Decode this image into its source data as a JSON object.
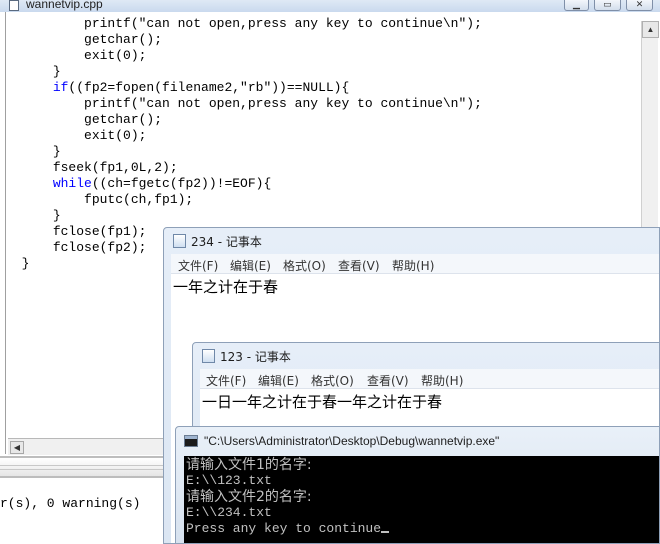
{
  "ide": {
    "title": "wannetvip.cpp",
    "code_lines": [
      {
        "indent": "        ",
        "kw": "",
        "text": "printf(\"can not open,press any key to continue\\n\");"
      },
      {
        "indent": "        ",
        "kw": "",
        "text": "getchar();"
      },
      {
        "indent": "        ",
        "kw": "",
        "text": "exit(0);"
      },
      {
        "indent": "    ",
        "kw": "",
        "text": "}"
      },
      {
        "indent": "    ",
        "kw": "if",
        "text": "((fp2=fopen(filename2,\"rb\"))==NULL){"
      },
      {
        "indent": "        ",
        "kw": "",
        "text": "printf(\"can not open,press any key to continue\\n\");"
      },
      {
        "indent": "        ",
        "kw": "",
        "text": "getchar();"
      },
      {
        "indent": "        ",
        "kw": "",
        "text": "exit(0);"
      },
      {
        "indent": "    ",
        "kw": "",
        "text": "}"
      },
      {
        "indent": "    ",
        "kw": "",
        "text": "fseek(fp1,0L,2);"
      },
      {
        "indent": "    ",
        "kw": "while",
        "text": "((ch=fgetc(fp2))!=EOF){"
      },
      {
        "indent": "        ",
        "kw": "",
        "text": "fputc(ch,fp1);"
      },
      {
        "indent": "    ",
        "kw": "",
        "text": "}"
      },
      {
        "indent": "    ",
        "kw": "",
        "text": "fclose(fp1);"
      },
      {
        "indent": "    ",
        "kw": "",
        "text": "fclose(fp2);"
      },
      {
        "indent": "",
        "kw": "",
        "text": "}"
      }
    ],
    "output_message": "r(s), 0 warning(s)",
    "keyword_color": "#0000ff"
  },
  "notepad_234": {
    "title": "234 - 记事本",
    "menu": [
      "文件(F)",
      "编辑(E)",
      "格式(O)",
      "查看(V)",
      "帮助(H)"
    ],
    "content": "一年之计在于春"
  },
  "notepad_123": {
    "title": "123 - 记事本",
    "menu": [
      "文件(F)",
      "编辑(E)",
      "格式(O)",
      "查看(V)",
      "帮助(H)"
    ],
    "content": "一日一年之计在于春一年之计在于春"
  },
  "console": {
    "title": "\"C:\\Users\\Administrator\\Desktop\\Debug\\wannetvip.exe\"",
    "lines": [
      {
        "style": "cjk",
        "text": "请输入文件1的名字:"
      },
      {
        "style": "mono",
        "text": "E:\\\\123.txt"
      },
      {
        "style": "cjk",
        "text": "请输入文件2的名字:"
      },
      {
        "style": "mono",
        "text": "E:\\\\234.txt"
      },
      {
        "style": "mono",
        "text": "Press any key to continue"
      }
    ]
  }
}
